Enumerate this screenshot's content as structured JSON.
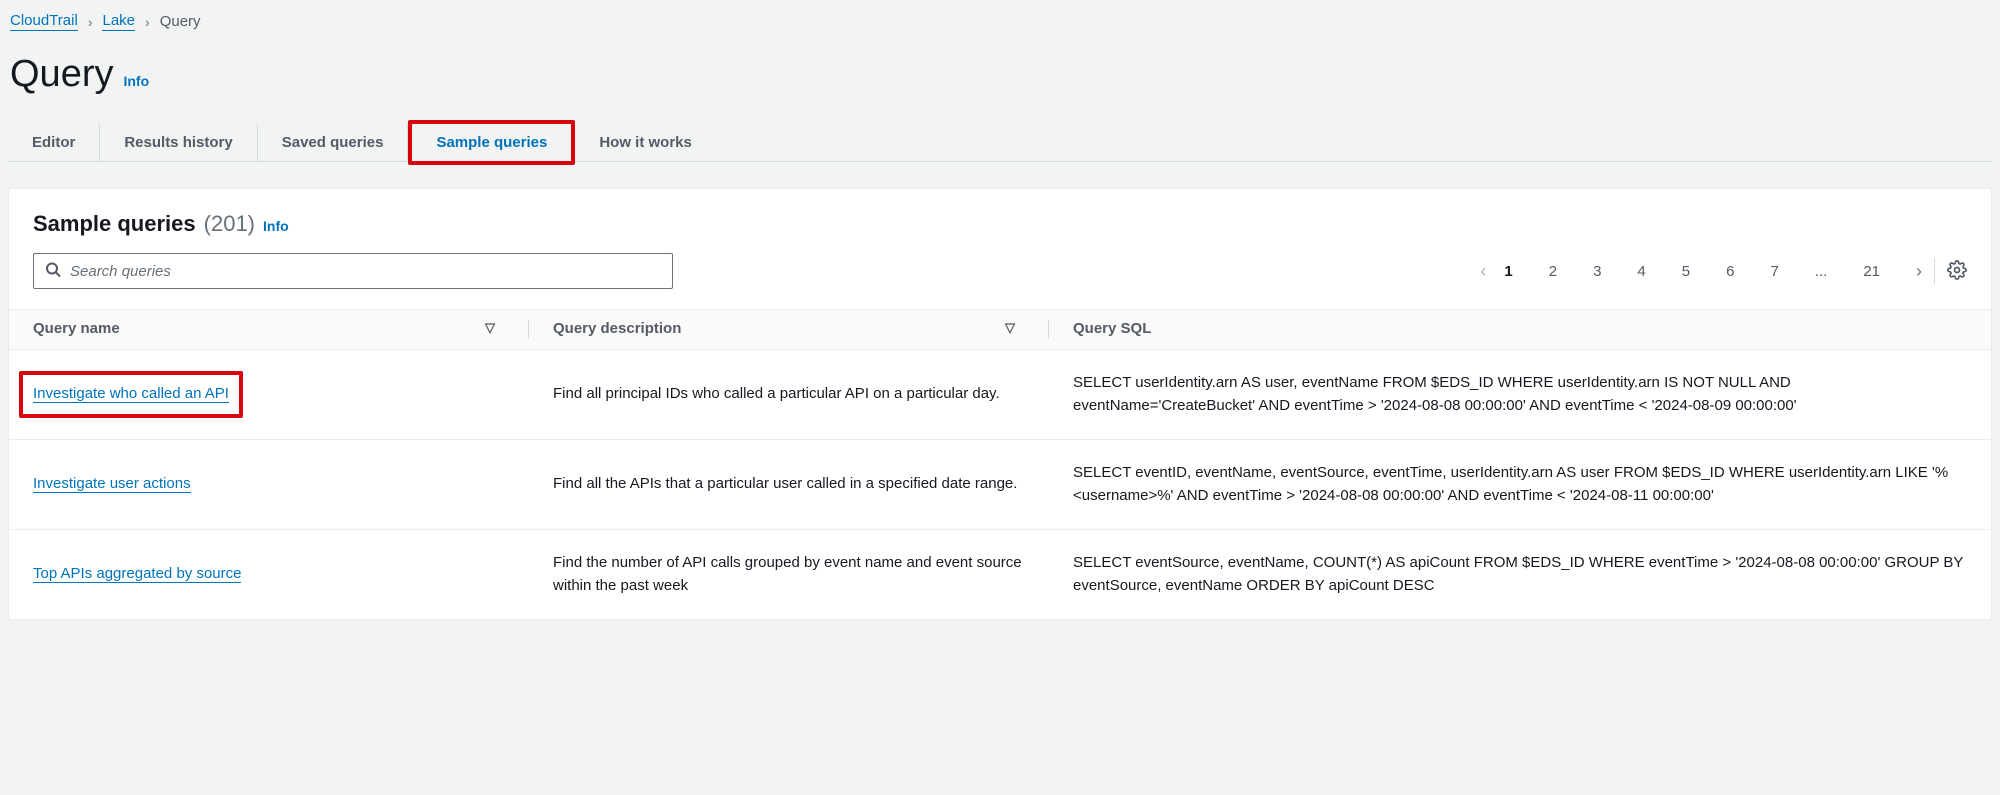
{
  "breadcrumb": {
    "root": "CloudTrail",
    "mid": "Lake",
    "current": "Query"
  },
  "page": {
    "title": "Query",
    "info": "Info"
  },
  "tabs": {
    "editor": "Editor",
    "results": "Results history",
    "saved": "Saved queries",
    "sample": "Sample queries",
    "how": "How it works"
  },
  "panel": {
    "title": "Sample queries",
    "count": "(201)",
    "info": "Info"
  },
  "search": {
    "placeholder": "Search queries"
  },
  "pagination": {
    "pages": [
      "1",
      "2",
      "3",
      "4",
      "5",
      "6",
      "7",
      "...",
      "21"
    ],
    "current": "1"
  },
  "columns": {
    "name": "Query name",
    "desc": "Query description",
    "sql": "Query SQL"
  },
  "rows": [
    {
      "name": "Investigate who called an API",
      "desc": "Find all principal IDs who called a particular API on a particular day.",
      "sql": "SELECT userIdentity.arn AS user, eventName FROM $EDS_ID WHERE userIdentity.arn IS NOT NULL AND eventName='CreateBucket' AND eventTime > '2024-08-08 00:00:00' AND eventTime < '2024-08-09 00:00:00'",
      "highlight": true
    },
    {
      "name": "Investigate user actions",
      "desc": "Find all the APIs that a particular user called in a specified date range.",
      "sql": "SELECT eventID, eventName, eventSource, eventTime, userIdentity.arn AS user FROM $EDS_ID WHERE userIdentity.arn LIKE '%<username>%' AND eventTime > '2024-08-08 00:00:00' AND eventTime < '2024-08-11 00:00:00'",
      "highlight": false
    },
    {
      "name": "Top APIs aggregated by source",
      "desc": "Find the number of API calls grouped by event name and event source within the past week",
      "sql": "SELECT eventSource, eventName, COUNT(*) AS apiCount FROM $EDS_ID WHERE eventTime > '2024-08-08 00:00:00' GROUP BY eventSource, eventName ORDER BY apiCount DESC",
      "highlight": false
    }
  ]
}
